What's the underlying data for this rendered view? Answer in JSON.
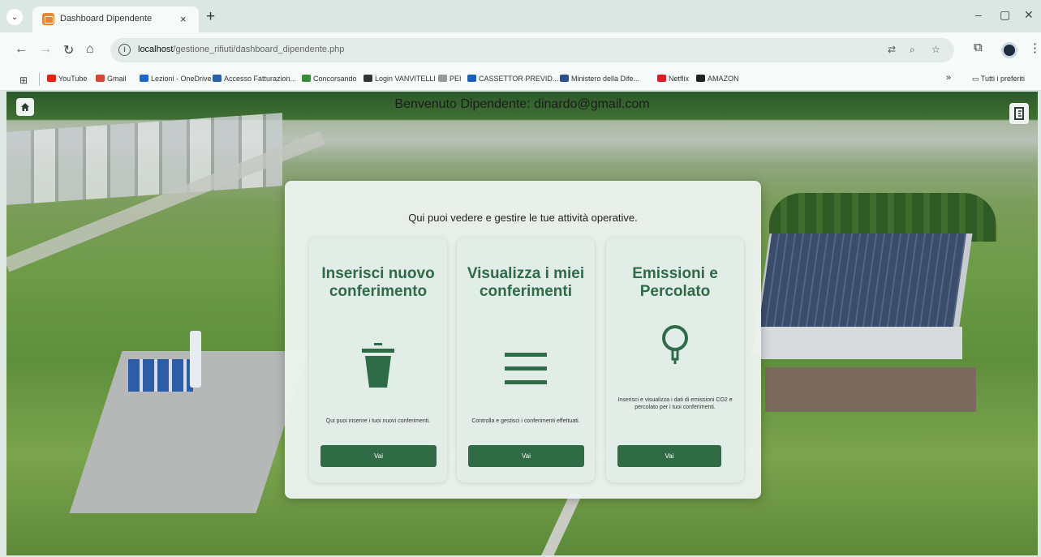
{
  "browser": {
    "tab": {
      "title": "Dashboard Dipendente",
      "close": "×"
    },
    "new_tab": "+",
    "window_controls": {
      "minimize": "–",
      "restore": "▢",
      "close": "✕"
    },
    "nav": {
      "back": "←",
      "forward": "→",
      "reload": "↻",
      "home": "⌂"
    },
    "url": {
      "host": "localhost",
      "path": "/gestione_rifiuti/dashboard_dipendente.php"
    },
    "bookmarks": [
      {
        "label": "YouTube",
        "color": "#e62117"
      },
      {
        "label": "Gmail",
        "color": "#d44638"
      },
      {
        "label": "Lezioni - OneDrive",
        "color": "#1e66c8"
      },
      {
        "label": "Accesso Fatturazion...",
        "color": "#2b5ea8"
      },
      {
        "label": "Concorsando",
        "color": "#3a8a3a"
      },
      {
        "label": "Login VANVITELLI",
        "color": "#333333"
      },
      {
        "label": "PEI",
        "color": "#999999"
      },
      {
        "label": "CASSETTOR PREVID...",
        "color": "#1c5fb8"
      },
      {
        "label": "Ministero della Dife...",
        "color": "#2d4f8a"
      },
      {
        "label": "Netflix",
        "color": "#d81f26"
      },
      {
        "label": "AMAZON",
        "color": "#222222"
      }
    ],
    "bookmarks_more": "»",
    "bookmarks_all": "Tutti i preferiti"
  },
  "page": {
    "welcome": "Benvenuto Dipendente: dinardo@gmail.com",
    "intro": "Qui puoi vedere e gestire le tue attività operative.",
    "cards": [
      {
        "title": "Inserisci nuovo conferimento",
        "icon": "waste-bin-icon",
        "description": "Qui puoi inserire i tuoi nuovi conferimenti.",
        "button": "Vai"
      },
      {
        "title": "Visualizza i miei conferimenti",
        "icon": "list-icon",
        "description": "Controlla e gestisci i conferimenti effettuati.",
        "button": "Vai"
      },
      {
        "title": "Emissioni e Percolato",
        "icon": "lightbulb-icon",
        "description": "Inserisci e visualizza i dati di emissioni CO2 e percolato per i tuoi conferimenti.",
        "button": "Vai"
      }
    ]
  },
  "colors": {
    "accent": "#2f6b45",
    "title": "#2e6b47",
    "panel": "#ecf2ee"
  }
}
